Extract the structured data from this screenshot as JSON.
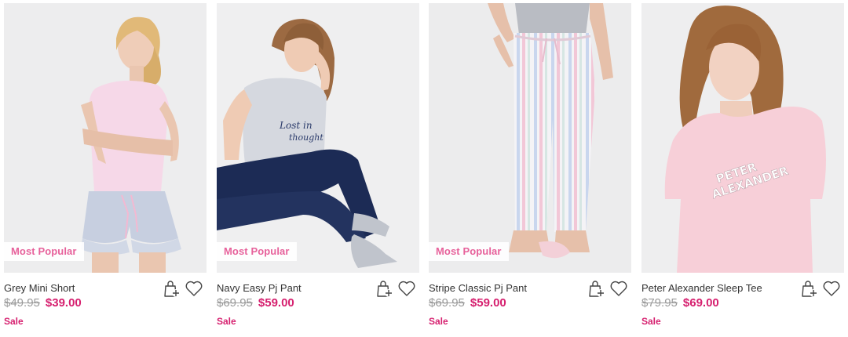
{
  "products": [
    {
      "name": "Grey Mini Short",
      "was_price": "$49.95",
      "now_price": "$39.00",
      "sale_label": "Sale",
      "badge": "Most Popular"
    },
    {
      "name": "Navy Easy Pj Pant",
      "was_price": "$69.95",
      "now_price": "$59.00",
      "sale_label": "Sale",
      "badge": "Most Popular"
    },
    {
      "name": "Stripe Classic Pj Pant",
      "was_price": "$69.95",
      "now_price": "$59.00",
      "sale_label": "Sale",
      "badge": "Most Popular"
    },
    {
      "name": "Peter Alexander Sleep Tee",
      "was_price": "$79.95",
      "now_price": "$69.00",
      "sale_label": "Sale"
    }
  ],
  "icons": {
    "add_to_bag": "bag-plus-icon",
    "wishlist": "heart-icon"
  },
  "colors": {
    "sale_price": "#d6206f",
    "badge_text": "#e7619b",
    "was_price": "#9a9a9a"
  }
}
